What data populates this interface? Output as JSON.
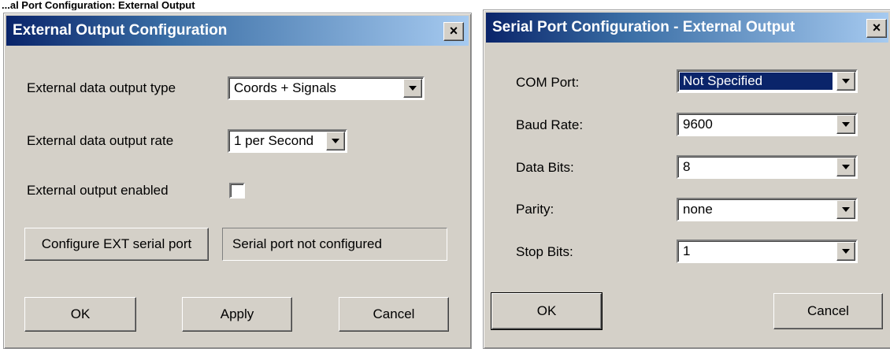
{
  "caption": "...al Port Configuration: External Output",
  "dialog1": {
    "title": "External Output Configuration",
    "close_glyph": "×",
    "output_type_label": "External data output type",
    "output_type_value": "Coords + Signals",
    "output_rate_label": "External data output rate",
    "output_rate_value": "1 per Second",
    "enabled_label": "External output enabled",
    "enabled_checked": false,
    "configure_button": "Configure EXT serial port",
    "serial_status": "Serial port not configured",
    "ok_button": "OK",
    "apply_button": "Apply",
    "cancel_button": "Cancel"
  },
  "dialog2": {
    "title": "Serial Port Configuration - External Output",
    "close_glyph": "×",
    "com_port_label": "COM Port:",
    "com_port_value": "Not Specified",
    "baud_rate_label": "Baud Rate:",
    "baud_rate_value": "9600",
    "data_bits_label": "Data Bits:",
    "data_bits_value": "8",
    "parity_label": "Parity:",
    "parity_value": "none",
    "stop_bits_label": "Stop Bits:",
    "stop_bits_value": "1",
    "ok_button": "OK",
    "cancel_button": "Cancel"
  },
  "colors": {
    "titlebar_start": "#0a246a",
    "titlebar_end": "#a6caf0",
    "dialog_face": "#d4d0c8",
    "selection": "#0a246a"
  },
  "icons": {
    "close": "close-icon",
    "dropdown": "chevron-down-icon"
  }
}
